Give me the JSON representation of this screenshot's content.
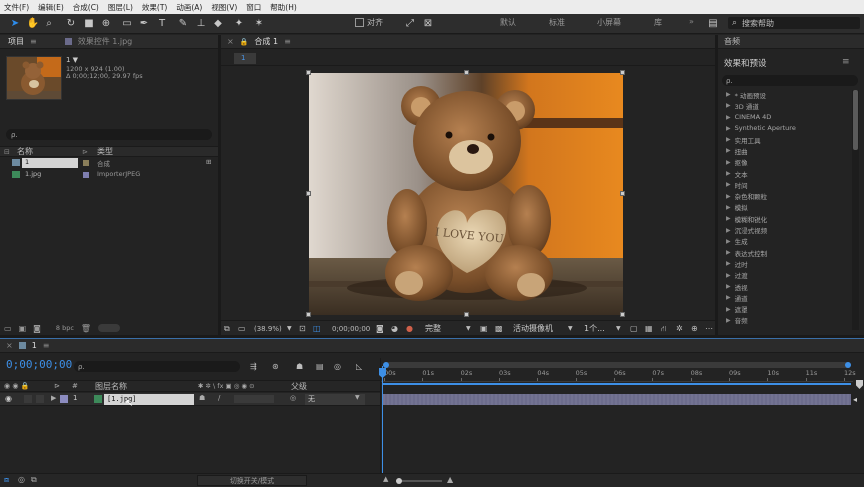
{
  "menu": [
    "文件(F)",
    "编辑(E)",
    "合成(C)",
    "图层(L)",
    "效果(T)",
    "动画(A)",
    "视图(V)",
    "窗口",
    "帮助(H)"
  ],
  "toolbar": {
    "snap_label": "对齐",
    "workspaces": [
      "默认",
      "标准",
      "小屏幕",
      "库"
    ],
    "search_help": "搜索帮助"
  },
  "project": {
    "tab_label": "项目",
    "effects_tab": "效果控件 1.jpg",
    "comp_name": "1 ▼",
    "comp_info_1": "1200 x 924 (1.00)",
    "comp_info_2": "Δ 0;00;12;00, 29.97 fps",
    "search_placeholder": "ρ.",
    "col_name": "名称",
    "col_type": "类型",
    "rows": [
      {
        "name": "1",
        "type": "合成"
      },
      {
        "name": "1.jpg",
        "type": "ImporterJPEG"
      }
    ],
    "bpc": "8 bpc"
  },
  "comp": {
    "tab_label": "合成 1",
    "chip_label": "1",
    "zoom": "(38.9%)",
    "timecode": "0;00;00;00",
    "quality": "完整",
    "camera": "活动摄像机",
    "views": "1个...",
    "heart_text": "I LOVE YOU"
  },
  "effects": {
    "panel_title": "音频",
    "title": "效果和预设",
    "search_placeholder": "ρ.",
    "items": [
      "* 动画预设",
      "3D 通道",
      "CINEMA 4D",
      "Synthetic Aperture",
      "实用工具",
      "扭曲",
      "抠像",
      "文本",
      "时间",
      "杂色和颗粒",
      "模拟",
      "模糊和锐化",
      "沉浸式视频",
      "生成",
      "表达式控制",
      "过时",
      "过渡",
      "透视",
      "通道",
      "遮罩",
      "音频"
    ]
  },
  "timeline": {
    "tab_label": "1",
    "timecode": "0;00;00;00",
    "search_placeholder": "ρ.",
    "col_layer": "图层名称",
    "col_parent": "父级",
    "layer": {
      "num": "1",
      "name": "[1.jpg]",
      "parent": "无"
    },
    "ticks": [
      "00s",
      "01s",
      "02s",
      "03s",
      "04s",
      "05s",
      "06s",
      "07s",
      "08s",
      "09s",
      "10s",
      "11s",
      "12s"
    ],
    "toggle_label": "切换开关/模式"
  }
}
